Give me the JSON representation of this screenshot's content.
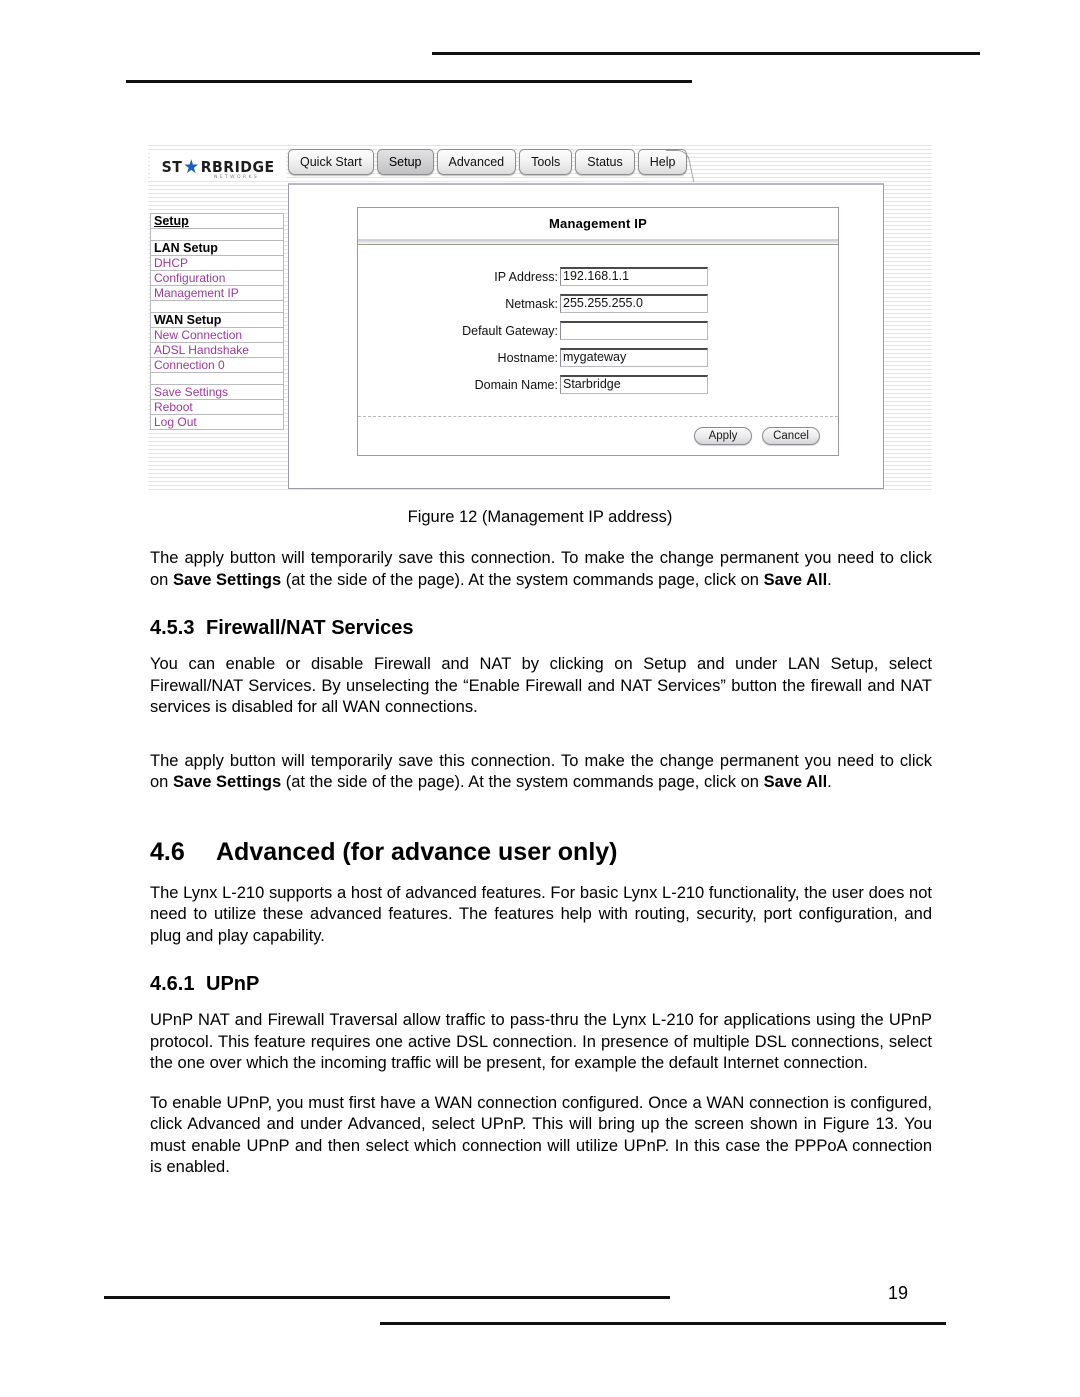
{
  "document": {
    "page_number": "19",
    "figure_caption": "Figure 12 (Management IP address)"
  },
  "figure": {
    "logo": {
      "text_left": "ST",
      "star": "★",
      "text_right": "RBRIDGE",
      "subtitle": "NETWORKS"
    },
    "tabs": [
      {
        "label": "Quick Start",
        "active": false
      },
      {
        "label": "Setup",
        "active": true
      },
      {
        "label": "Advanced",
        "active": false
      },
      {
        "label": "Tools",
        "active": false
      },
      {
        "label": "Status",
        "active": false
      },
      {
        "label": "Help",
        "active": false
      }
    ],
    "sidebar": {
      "title": "Setup",
      "groups": [
        {
          "heading": "LAN Setup",
          "links": [
            "DHCP",
            "Configuration",
            "Management IP"
          ]
        },
        {
          "heading": "WAN Setup",
          "links": [
            "New Connection",
            "ADSL Handshake",
            "Connection 0"
          ]
        }
      ],
      "actions": [
        "Save Settings",
        "Reboot",
        "Log Out"
      ]
    },
    "panel": {
      "title": "Management IP",
      "fields": [
        {
          "label": "IP Address:",
          "value": "192.168.1.1"
        },
        {
          "label": "Netmask:",
          "value": "255.255.255.0"
        },
        {
          "label": "Default Gateway:",
          "value": ""
        },
        {
          "label": "Hostname:",
          "value": "mygateway"
        },
        {
          "label": "Domain Name:",
          "value": "Starbridge"
        }
      ],
      "apply_label": "Apply",
      "cancel_label": "Cancel"
    }
  },
  "sections": {
    "para_after_figure": {
      "t1": "The apply button will temporarily save this connection. To make the change permanent you need to click on ",
      "b1": "Save Settings",
      "t2": " (at the side of the page).  At the system commands page, click on ",
      "b2": "Save All",
      "t3": "."
    },
    "s453": {
      "number": "4.5.3",
      "title": "Firewall/NAT Services",
      "body": "You can enable or disable Firewall and NAT by clicking on Setup and under LAN Setup, select Firewall/NAT Services.  By unselecting the “Enable Firewall and NAT Services” button the firewall and NAT services is disabled for all WAN connections."
    },
    "para_after_453": {
      "t1": "The apply button will temporarily save this connection. To make the change permanent you need to click on ",
      "b1": "Save Settings",
      "t2": " (at the side of the page).  At the system commands page, click on ",
      "b2": "Save All",
      "t3": "."
    },
    "s46": {
      "number": "4.6",
      "title": "Advanced (for advance user only)",
      "body": "The Lynx L-210 supports a host of advanced features.  For basic Lynx L-210 functionality, the user does not need to utilize these advanced features.  The features help with routing, security, port configuration, and plug and play capability."
    },
    "s461": {
      "number": "4.6.1",
      "title": "UPnP",
      "body1": "UPnP NAT and Firewall Traversal allow traffic to pass-thru the Lynx L-210 for applications using the UPnP protocol. This feature requires one active DSL connection. In presence of multiple DSL connections, select the one over which the incoming traffic will be present, for example the default Internet connection.",
      "body2": "To enable UPnP, you must first have a WAN connection configured.  Once a WAN connection is configured, click Advanced and under Advanced, select UPnP.  This will bring up the screen shown in Figure 13.    You must enable UPnP and then select which connection will utilize UPnP.  In this case the PPPoA connection is enabled."
    }
  }
}
